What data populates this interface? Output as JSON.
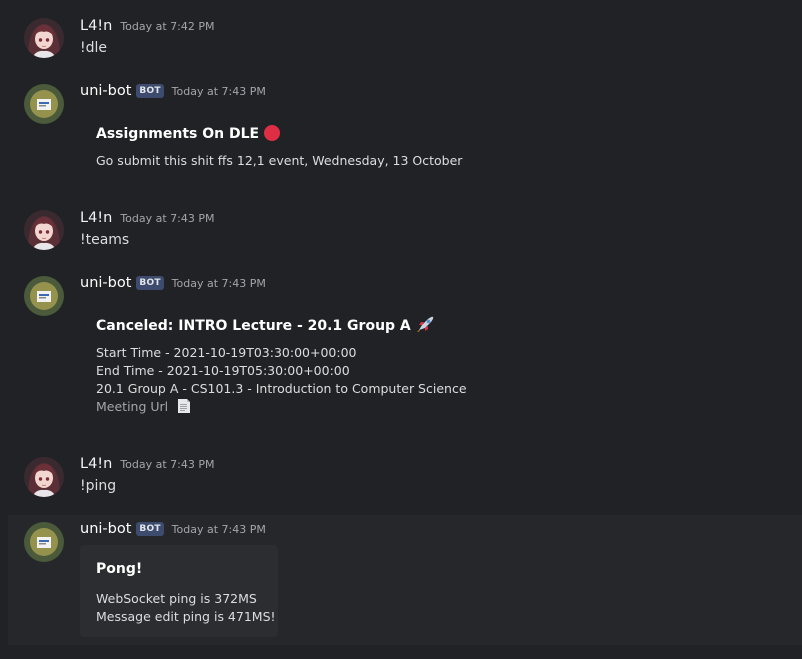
{
  "messages": [
    {
      "author": "L4!n",
      "timestamp": "Today at 7:42 PM",
      "text": "!dle"
    },
    {
      "author": "uni-bot",
      "bot_tag": "BOT",
      "timestamp": "Today at 7:43 PM",
      "embed": {
        "title": "Assignments On DLE",
        "title_emoji": "red-circle-icon",
        "lines": [
          "Go submit this shit ffs 12,1 event, Wednesday, 13 October"
        ]
      }
    },
    {
      "author": "L4!n",
      "timestamp": "Today at 7:43 PM",
      "text": "!teams"
    },
    {
      "author": "uni-bot",
      "bot_tag": "BOT",
      "timestamp": "Today at 7:43 PM",
      "embed": {
        "title": "Canceled: INTRO Lecture - 20.1 Group A",
        "title_emoji": "rocket-icon",
        "lines": [
          "Start Time - 2021-10-19T03:30:00+00:00",
          "End Time - 2021-10-19T05:30:00+00:00",
          "20.1 Group A - CS101.3 - Introduction to Computer Science"
        ],
        "link": "Meeting Url",
        "link_emoji": "page-icon"
      }
    },
    {
      "author": "L4!n",
      "timestamp": "Today at 7:43 PM",
      "text": "!ping"
    },
    {
      "author": "uni-bot",
      "bot_tag": "BOT",
      "timestamp": "Today at 7:43 PM",
      "embed": {
        "title": "Pong!",
        "lines": [
          "WebSocket ping is 372MS",
          "Message edit ping is 471MS!"
        ]
      }
    }
  ],
  "colors": {
    "background": "#202225",
    "hover_background": "#25272b",
    "embed_background": "#2b2d31",
    "text": "#dcddde",
    "muted": "#a3a6aa",
    "bot_tag": "#3c4b6e",
    "red_circle": "#dd2e44"
  }
}
